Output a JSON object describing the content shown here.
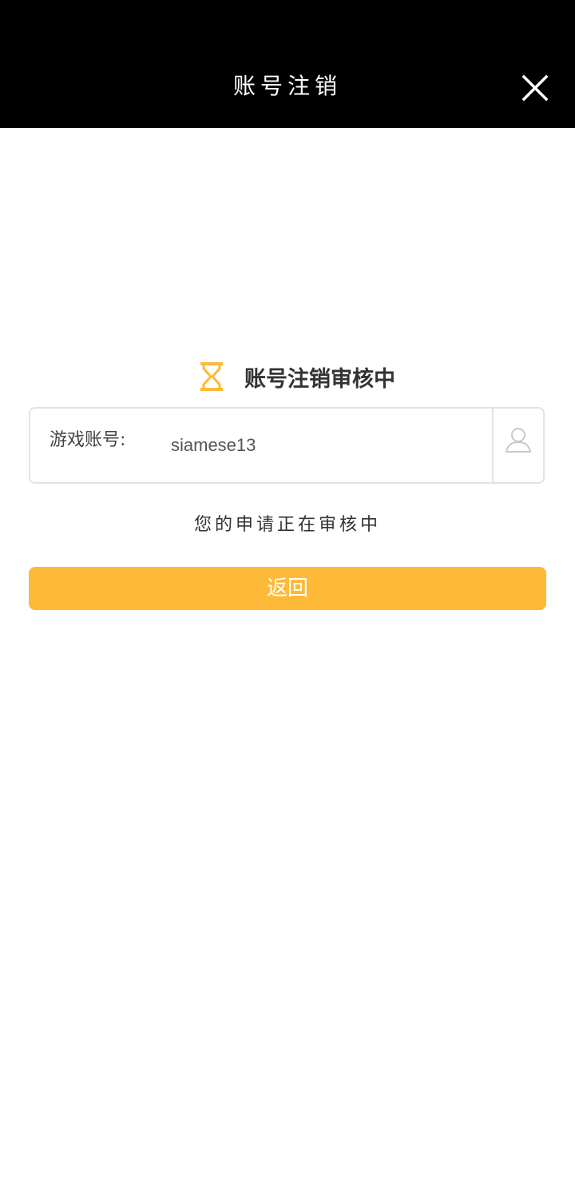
{
  "header": {
    "title": "账号注销",
    "close_icon": "close-icon"
  },
  "status": {
    "icon": "hourglass-icon",
    "text": "账号注销审核中"
  },
  "account": {
    "label": "游戏账号:",
    "value": "siamese13",
    "icon": "user-icon"
  },
  "message": "您的申请正在审核中",
  "back_button": {
    "label": "返回"
  },
  "colors": {
    "accent": "#fdb937",
    "header_bg": "#000000",
    "border": "#e3e3e3"
  }
}
